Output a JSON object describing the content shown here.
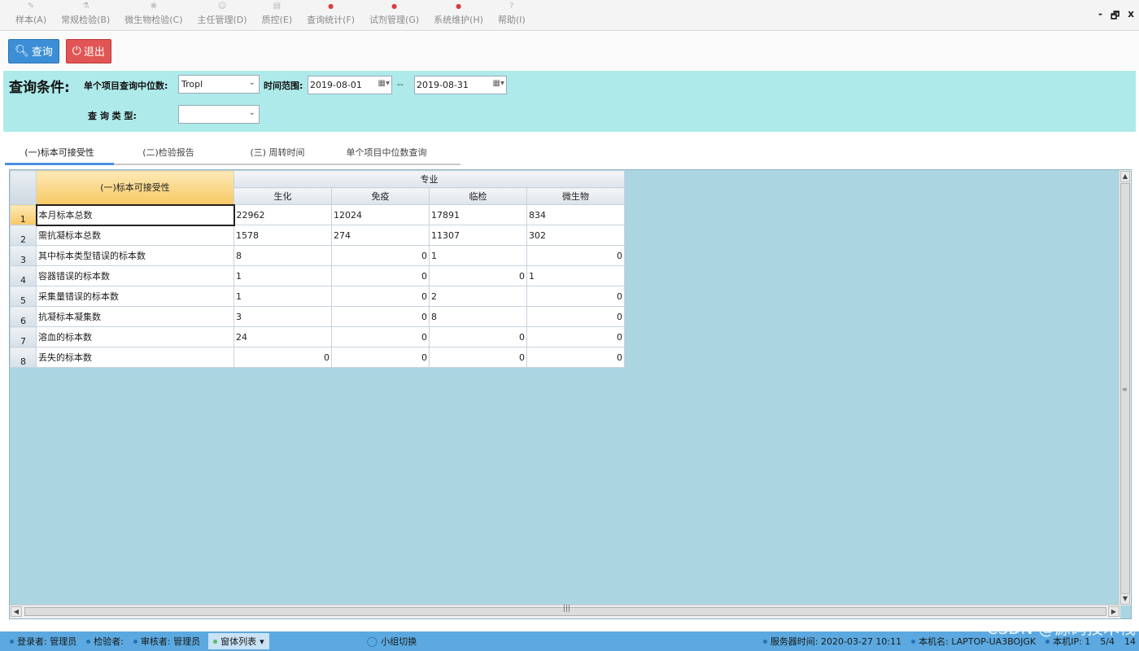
{
  "menu": [
    {
      "label": "样本(A)",
      "icon": "pencil-icon"
    },
    {
      "label": "常规检验(B)",
      "icon": "flask-icon"
    },
    {
      "label": "微生物检验(C)",
      "icon": "microbe-icon"
    },
    {
      "label": "主任管理(D)",
      "icon": "people-icon"
    },
    {
      "label": "质控(E)",
      "icon": "doc-icon"
    },
    {
      "label": "查询统计(F)",
      "icon": "red-dot-icon"
    },
    {
      "label": "试剂管理(G)",
      "icon": "red-dot-icon"
    },
    {
      "label": "系统维护(H)",
      "icon": "red-dot-icon"
    },
    {
      "label": "帮助(I)",
      "icon": "help-icon"
    }
  ],
  "window_controls": {
    "minimize": "-",
    "restore": "🗗",
    "close": "x"
  },
  "toolbar": {
    "query_label": "查询",
    "exit_label": "退出"
  },
  "query_panel": {
    "title": "查询条件:",
    "median_label": "单个项目查询中位数:",
    "median_value": "Tropl",
    "time_label": "时间范围:",
    "date_from": "2019-08-01",
    "date_sep": "--",
    "date_to": "2019-08-31",
    "type_label": "查 询 类 型:",
    "type_value": ""
  },
  "tabs": [
    "(一)标本可接受性",
    "(二)检验报告",
    "(三) 周转时间",
    "单个项目中位数查询"
  ],
  "grid": {
    "first_header": "(一)标本可接受性",
    "group_header": "专业",
    "columns": [
      "生化",
      "免疫",
      "临检",
      "微生物"
    ],
    "rows": [
      {
        "num": "1",
        "name": "本月标本总数",
        "cells": [
          {
            "v": "22962",
            "a": "l"
          },
          {
            "v": "12024",
            "a": "l"
          },
          {
            "v": "17891",
            "a": "l"
          },
          {
            "v": "834",
            "a": "l"
          }
        ]
      },
      {
        "num": "2",
        "name": "需抗凝标本总数",
        "cells": [
          {
            "v": "1578",
            "a": "l"
          },
          {
            "v": "274",
            "a": "l"
          },
          {
            "v": "11307",
            "a": "l"
          },
          {
            "v": "302",
            "a": "l"
          }
        ]
      },
      {
        "num": "3",
        "name": "其中标本类型错误的标本数",
        "cells": [
          {
            "v": "8",
            "a": "l"
          },
          {
            "v": "0",
            "a": "r"
          },
          {
            "v": "1",
            "a": "l"
          },
          {
            "v": "0",
            "a": "r"
          }
        ]
      },
      {
        "num": "4",
        "name": "容器错误的标本数",
        "cells": [
          {
            "v": "1",
            "a": "l"
          },
          {
            "v": "0",
            "a": "r"
          },
          {
            "v": "0",
            "a": "r"
          },
          {
            "v": "1",
            "a": "l"
          }
        ]
      },
      {
        "num": "5",
        "name": "采集量错误的标本数",
        "cells": [
          {
            "v": "1",
            "a": "l"
          },
          {
            "v": "0",
            "a": "r"
          },
          {
            "v": "2",
            "a": "l"
          },
          {
            "v": "0",
            "a": "r"
          }
        ]
      },
      {
        "num": "6",
        "name": "抗凝标本凝集数",
        "cells": [
          {
            "v": "3",
            "a": "l"
          },
          {
            "v": "0",
            "a": "r"
          },
          {
            "v": "8",
            "a": "l"
          },
          {
            "v": "0",
            "a": "r"
          }
        ]
      },
      {
        "num": "7",
        "name": "溶血的标本数",
        "cells": [
          {
            "v": "24",
            "a": "l"
          },
          {
            "v": "0",
            "a": "r"
          },
          {
            "v": "0",
            "a": "r"
          },
          {
            "v": "0",
            "a": "r"
          }
        ]
      },
      {
        "num": "8",
        "name": "丢失的标本数",
        "cells": [
          {
            "v": "0",
            "a": "r"
          },
          {
            "v": "0",
            "a": "r"
          },
          {
            "v": "0",
            "a": "r"
          },
          {
            "v": "0",
            "a": "r"
          }
        ]
      }
    ]
  },
  "status": {
    "login": "登录者: 管理员",
    "checker": "检验者:",
    "reviewer": "审核者: 管理员",
    "window_list": "窗体列表",
    "group_switch": "小组切换",
    "server_time": "服务器时间: 2020-03-27 10:11",
    "host": "本机名: LAPTOP-UA3BOJGK",
    "ip": "本机IP: 1",
    "extra1": "5/4",
    "extra2": "14"
  },
  "watermark": "CSDN @源码技术栈"
}
